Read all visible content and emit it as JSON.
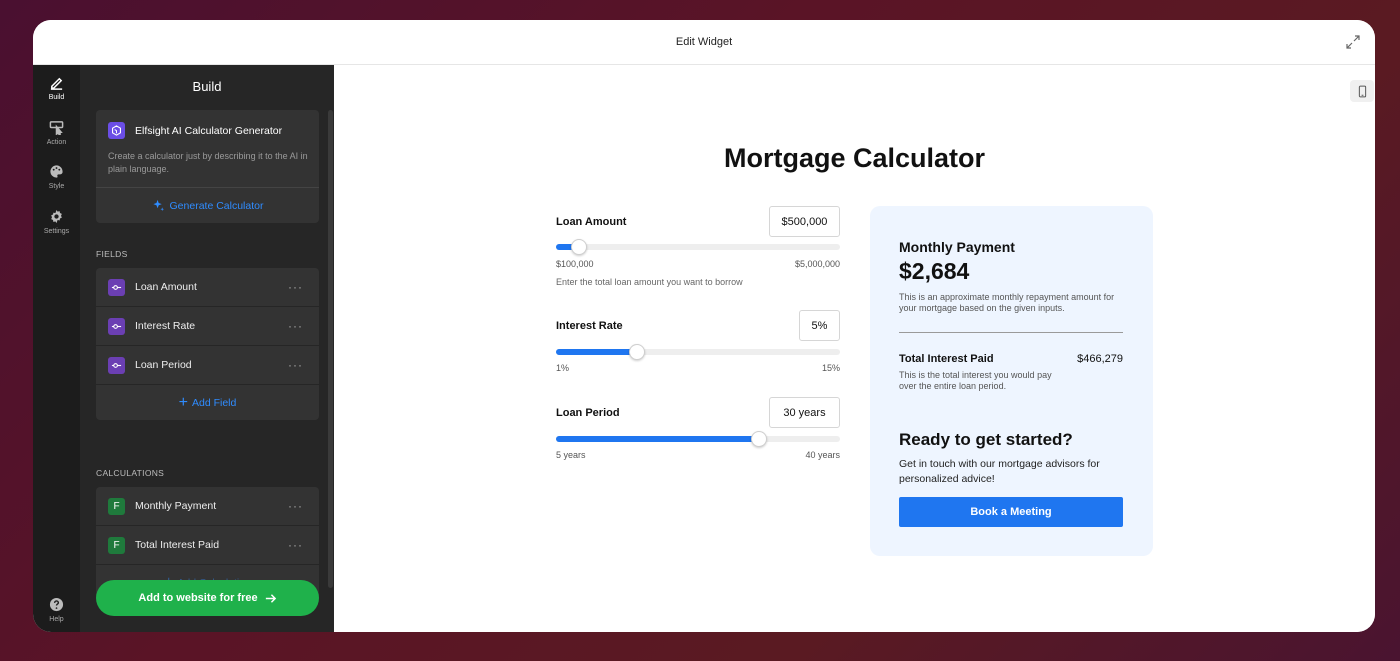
{
  "window": {
    "title": "Edit Widget"
  },
  "rail": {
    "items": [
      {
        "label": "Build",
        "icon": "pencil-icon",
        "active": true
      },
      {
        "label": "Action",
        "icon": "cursor-icon"
      },
      {
        "label": "Style",
        "icon": "palette-icon"
      },
      {
        "label": "Settings",
        "icon": "gear-icon"
      }
    ],
    "help_label": "Help"
  },
  "panel": {
    "title": "Build",
    "ai": {
      "title": "Elfsight AI Calculator Generator",
      "description": "Create a calculator just by describing it to the AI in plain language.",
      "button_label": "Generate Calculator"
    },
    "fields_label": "FIELDS",
    "fields": [
      {
        "label": "Loan Amount"
      },
      {
        "label": "Interest Rate"
      },
      {
        "label": "Loan Period"
      }
    ],
    "add_field_label": "Add Field",
    "calculations_label": "CALCULATIONS",
    "calculations": [
      {
        "label": "Monthly Payment",
        "badge": "F"
      },
      {
        "label": "Total Interest Paid",
        "badge": "F"
      }
    ],
    "add_calculation_label": "Add Calculation",
    "cta_label": "Add to website for free",
    "more_glyph": "···"
  },
  "calculator": {
    "title": "Mortgage Calculator",
    "fields": [
      {
        "label": "Loan Amount",
        "value": "$500,000",
        "min_label": "$100,000",
        "max_label": "$5,000,000",
        "help": "Enter the total loan amount you want to borrow",
        "min": 100000,
        "max": 5000000,
        "current": 500000
      },
      {
        "label": "Interest Rate",
        "value": "5%",
        "min_label": "1%",
        "max_label": "15%",
        "min": 1,
        "max": 15,
        "current": 5
      },
      {
        "label": "Loan Period",
        "value": "30 years",
        "min_label": "5 years",
        "max_label": "40 years",
        "min": 5,
        "max": 40,
        "current": 30
      }
    ],
    "result": {
      "title": "Monthly Payment",
      "amount": "$2,684",
      "description": "This is an approximate monthly repayment amount for your mortgage based on the given inputs.",
      "secondary_title": "Total Interest Paid",
      "secondary_value": "$466,279",
      "secondary_description": "This is the total interest you would pay over the entire loan period.",
      "cta_title": "Ready to get started?",
      "cta_text": "Get in touch with our mortgage advisors for personalized advice!",
      "cta_button": "Book a Meeting"
    }
  },
  "colors": {
    "accent": "#1f76f0",
    "cta_green": "#1fb14b",
    "result_bg": "#eef5ff"
  }
}
